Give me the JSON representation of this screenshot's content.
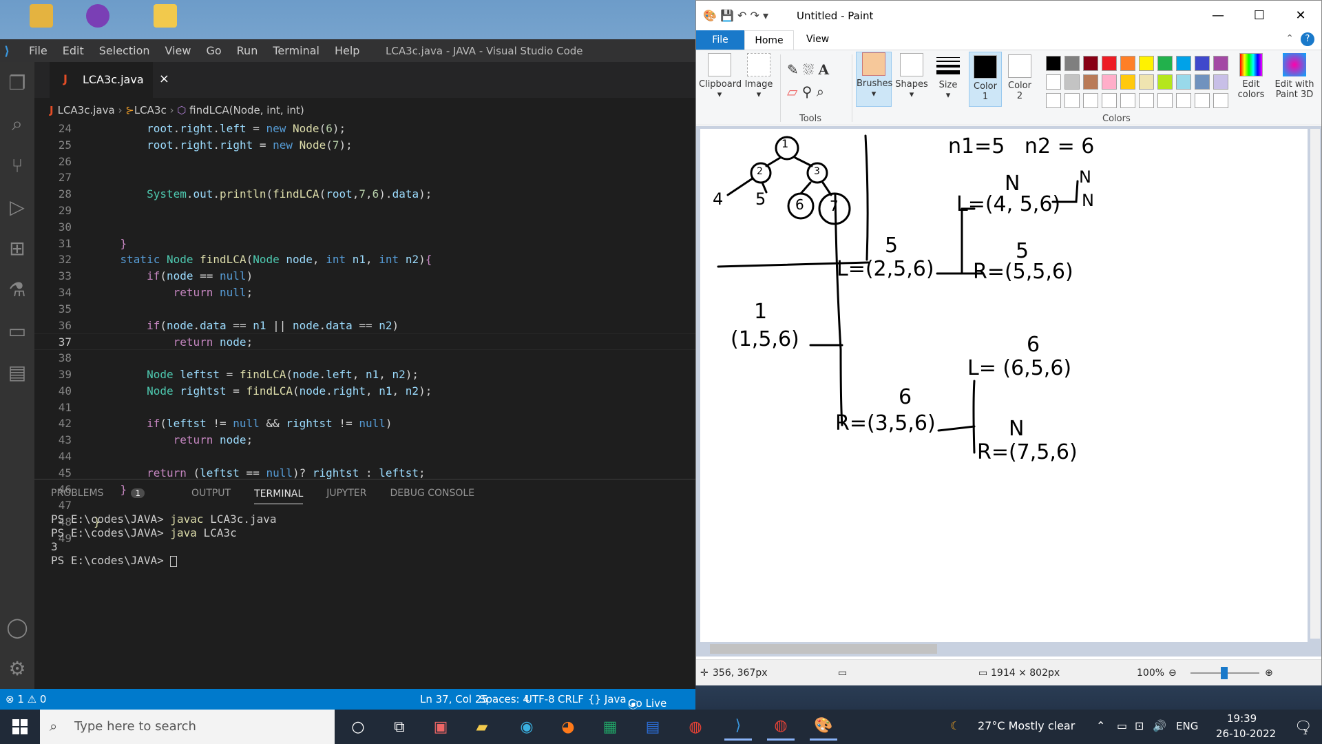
{
  "vscode": {
    "menu": [
      "File",
      "Edit",
      "Selection",
      "View",
      "Go",
      "Run",
      "Terminal",
      "Help"
    ],
    "window_title": "LCA3c.java - JAVA - Visual Studio Code",
    "tab_label": "LCA3c.java",
    "breadcrumb": {
      "file": "LCA3c.java",
      "class": "LCA3c",
      "method": "findLCA(Node, int, int)"
    },
    "line_numbers": [
      "24",
      "25",
      "26",
      "27",
      "28",
      "29",
      "30",
      "31",
      "32",
      "33",
      "34",
      "35",
      "36",
      "37",
      "38",
      "39",
      "40",
      "41",
      "42",
      "43",
      "44",
      "45",
      "46",
      "47",
      "48",
      "49"
    ],
    "panel_tabs": [
      "PROBLEMS",
      "OUTPUT",
      "TERMINAL",
      "JUPYTER",
      "DEBUG CONSOLE"
    ],
    "problems_count": "1",
    "terminal": {
      "lines": [
        {
          "prompt": "PS E:\\codes\\JAVA> ",
          "cmd": "javac",
          "rest": " LCA3c.java"
        },
        {
          "prompt": "PS E:\\codes\\JAVA> ",
          "cmd": "java",
          "rest": " LCA3c"
        },
        {
          "prompt": "3",
          "cmd": "",
          "rest": ""
        },
        {
          "prompt": "PS E:\\codes\\JAVA> ",
          "cmd": "",
          "rest": ""
        }
      ]
    },
    "status": {
      "errors": "⊗ 1 ⚠ 0",
      "position": "Ln 37, Col 25",
      "spaces": "Spaces: 4",
      "encoding": "UTF-8",
      "eol": "CRLF",
      "language": "{} Java",
      "golive": "Go Live"
    }
  },
  "paint": {
    "title": "Untitled - Paint",
    "tabs": {
      "file": "File",
      "home": "Home",
      "view": "View"
    },
    "ribbon": {
      "clipboard": "Clipboard",
      "image": "Image",
      "tools": "Tools",
      "brushes": "Brushes",
      "shapes": "Shapes",
      "size": "Size",
      "color1": "Color 1",
      "color2": "Color 2",
      "colors": "Colors",
      "edit_colors": "Edit colors",
      "edit_paint3d": "Edit with Paint 3D"
    },
    "palette_row1": [
      "#000000",
      "#7f7f7f",
      "#880015",
      "#ed1c24",
      "#ff7f27",
      "#fff200",
      "#22b14c",
      "#00a2e8",
      "#3f48cc",
      "#a349a4"
    ],
    "palette_row2": [
      "#ffffff",
      "#c3c3c3",
      "#b97a57",
      "#ffaec9",
      "#ffc90e",
      "#efe4b0",
      "#b5e61d",
      "#99d9ea",
      "#7092be",
      "#c8bfe7"
    ],
    "status": {
      "cursor": "356, 367px",
      "size": "1914 × 802px",
      "zoom": "100%"
    },
    "drawing": {
      "n_values": "n1=5   n2 = 6",
      "nodes": [
        "1",
        "2",
        "3",
        "4",
        "5",
        "6",
        "7"
      ],
      "calls": [
        {
          "label": "(1,5,6)",
          "result": "1"
        },
        {
          "label": "L=(2,5,6)",
          "result": "5"
        },
        {
          "label": "L=(4, 5,6)",
          "result": "N"
        },
        {
          "label": "R=(5,5,6)",
          "result": "5"
        },
        {
          "label": "R=(3,5,6)",
          "result": "6"
        },
        {
          "label": "L= (6,5,6)",
          "result": "6"
        },
        {
          "label": "R=(7,5,6)",
          "result": "N"
        }
      ],
      "n_marks": [
        "N",
        "N"
      ]
    }
  },
  "taskbar": {
    "search_placeholder": "Type here to search",
    "weather": "27°C  Mostly clear",
    "lang": "ENG",
    "time": "19:39",
    "date": "26-10-2022",
    "notif_count": "1"
  }
}
